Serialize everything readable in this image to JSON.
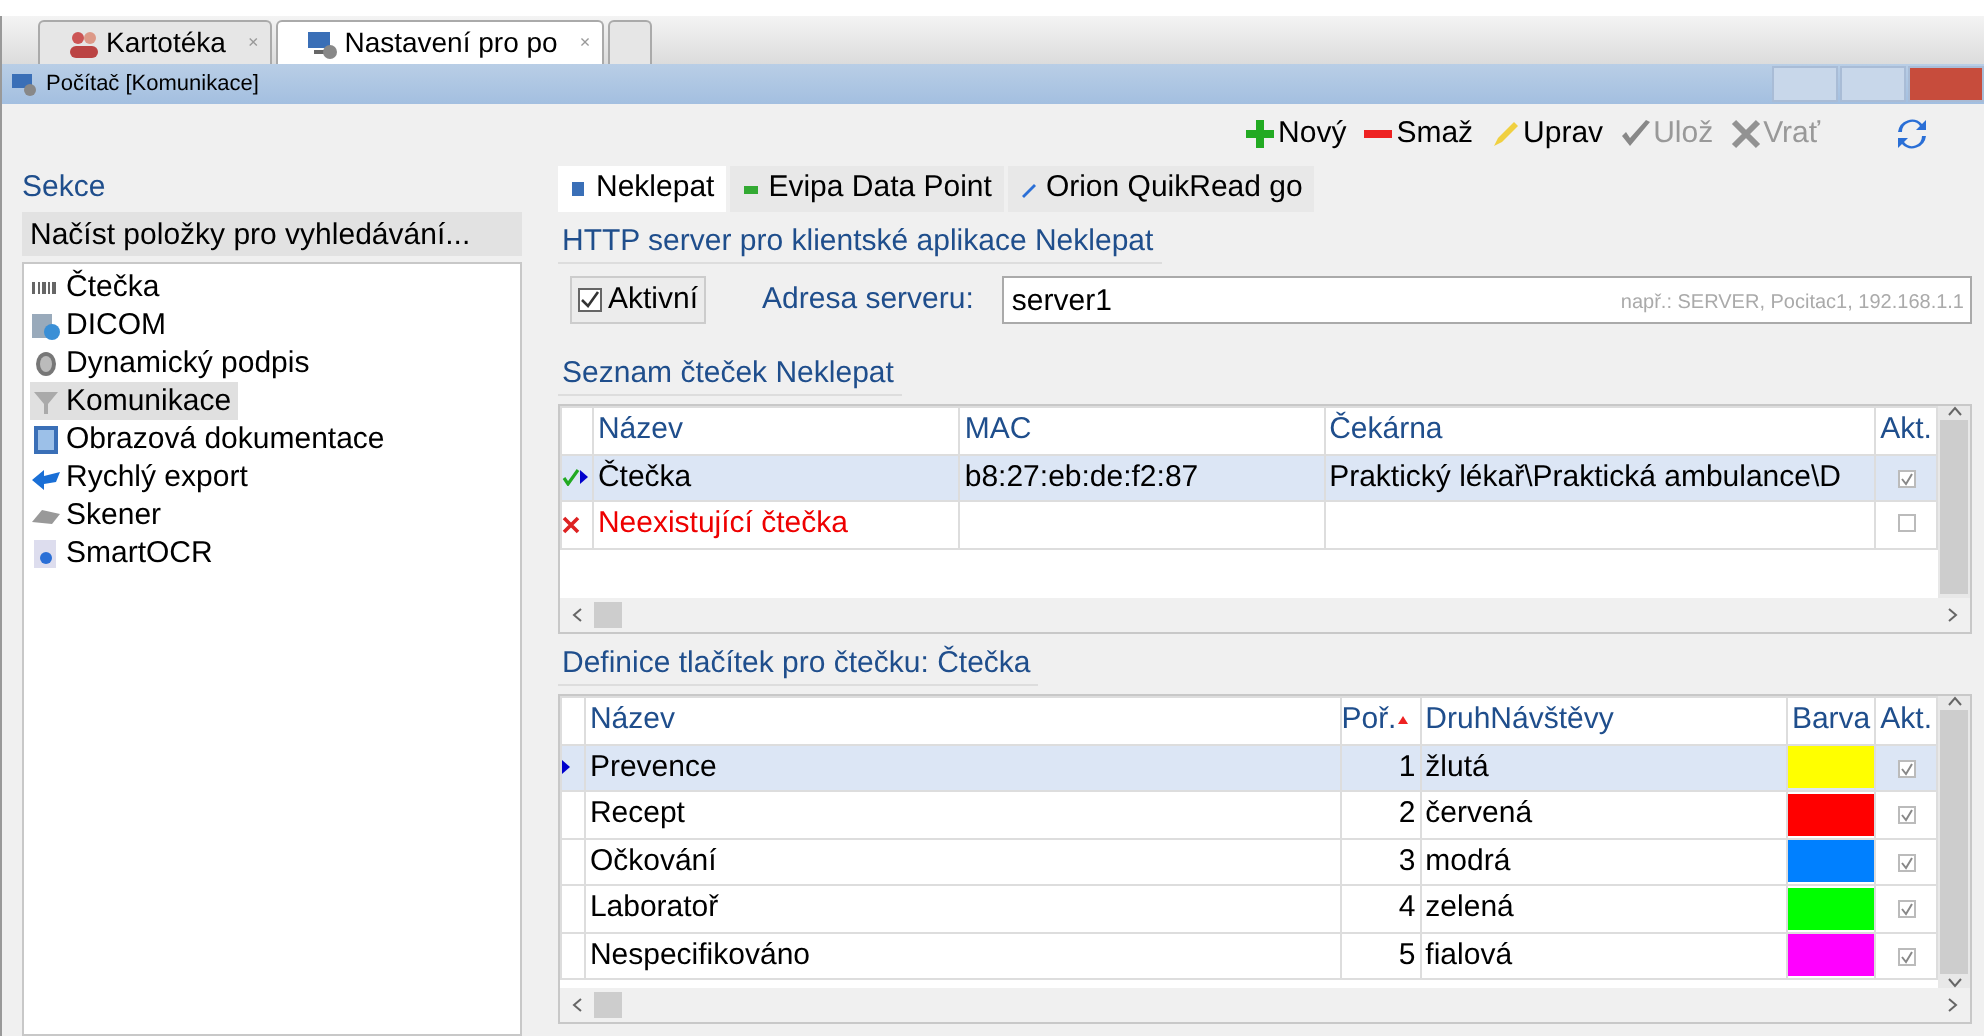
{
  "doc_tabs": [
    {
      "label": "Kartotéka",
      "close": "×",
      "selected": false,
      "kind": "people"
    },
    {
      "label": "Nastavení pro po",
      "close": "×",
      "selected": true,
      "kind": "settings"
    }
  ],
  "window": {
    "title": "Počítač [Komunikace]"
  },
  "toolbar": [
    {
      "label": "Nový",
      "kind": "add",
      "disabled": false
    },
    {
      "label": "Smaž",
      "kind": "delete",
      "disabled": false
    },
    {
      "label": "Uprav",
      "kind": "edit",
      "disabled": false
    },
    {
      "label": "Ulož",
      "kind": "save",
      "disabled": true
    },
    {
      "label": "Vrať",
      "kind": "undo",
      "disabled": true
    },
    {
      "kind": "refresh",
      "disabled": false
    }
  ],
  "sidebar": {
    "heading": "Sekce",
    "load_button": "Načíst položky pro vyhledávání...",
    "items": [
      {
        "label": "Čtečka",
        "kind": "barcode",
        "selected": false
      },
      {
        "label": "DICOM",
        "kind": "dicom",
        "selected": false
      },
      {
        "label": "Dynamický podpis",
        "kind": "fingerprint",
        "selected": false
      },
      {
        "label": "Komunikace",
        "kind": "funnel",
        "selected": true
      },
      {
        "label": "Obrazová dokumentace",
        "kind": "film",
        "selected": false
      },
      {
        "label": "Rychlý export",
        "kind": "arrow",
        "selected": false
      },
      {
        "label": "Skener",
        "kind": "scanner",
        "selected": false
      },
      {
        "label": "SmartOCR",
        "kind": "ocr",
        "selected": false
      }
    ]
  },
  "tabs": [
    {
      "label": "Neklepat",
      "selected": true
    },
    {
      "label": "Evipa Data Point",
      "selected": false
    },
    {
      "label": "Orion QuikRead go",
      "selected": false
    }
  ],
  "http_section": {
    "heading": "HTTP server pro klientské aplikace Neklepat",
    "active": {
      "label": "Aktivní",
      "checked": true
    },
    "address_label": "Adresa serveru:",
    "address_value": "server1",
    "hint": "např.: SERVER, Pocitac1, 192.168.1.1"
  },
  "readers": {
    "heading": "Seznam čteček Neklepat",
    "columns": [
      "Název",
      "MAC",
      "Čekárna",
      "Akt."
    ],
    "rows": [
      {
        "kind": "ok",
        "selected": true,
        "name": "Čtečka",
        "mac": "b8:27:eb:de:f2:87",
        "waiting_room": "Praktický lékař\\Praktická ambulance\\D",
        "active": true
      },
      {
        "kind": "missing",
        "selected": false,
        "name": "Neexistující čtečka",
        "mac": "",
        "waiting_room": "",
        "active": false
      }
    ]
  },
  "buttons": {
    "heading": "Definice tlačítek pro čtečku: Čtečka",
    "columns": [
      {
        "label": "Název",
        "sorted": false
      },
      {
        "label": "Poř.",
        "sorted": true
      },
      {
        "label": "DruhNávštěvy",
        "sorted": false
      },
      {
        "label": "Barva",
        "sorted": false
      },
      {
        "label": "Akt.",
        "sorted": false
      }
    ],
    "rows": [
      {
        "selected": true,
        "name": "Prevence",
        "order": "1",
        "visit_type": "žlutá",
        "color": "#ffff00",
        "active": true
      },
      {
        "selected": false,
        "name": "Recept",
        "order": "2",
        "visit_type": "červená",
        "color": "#ff0000",
        "active": true
      },
      {
        "selected": false,
        "name": "Očkování",
        "order": "3",
        "visit_type": "modrá",
        "color": "#0080ff",
        "active": true
      },
      {
        "selected": false,
        "name": "Laboratoř",
        "order": "4",
        "visit_type": "zelená",
        "color": "#00ff00",
        "active": true
      },
      {
        "selected": false,
        "name": "Nespecifikováno",
        "order": "5",
        "visit_type": "fialová",
        "color": "#ff00ff",
        "active": true
      }
    ]
  }
}
